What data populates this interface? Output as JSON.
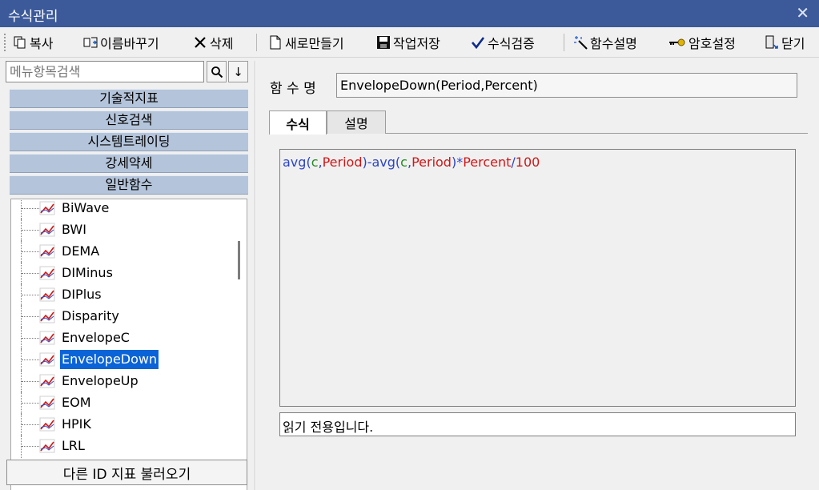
{
  "window": {
    "title": "수식관리"
  },
  "toolbar": {
    "copy": "복사",
    "rename": "이름바꾸기",
    "delete": "삭제",
    "new": "새로만들기",
    "save": "작업저장",
    "verify": "수식검증",
    "func_help": "함수설명",
    "password": "암호설정",
    "close": "닫기"
  },
  "search": {
    "placeholder": "메뉴항목검색"
  },
  "categories": [
    "기술적지표",
    "신호검색",
    "시스템트레이딩",
    "강세약세",
    "일반함수"
  ],
  "tree": {
    "items": [
      "BiWave",
      "BWI",
      "DEMA",
      "DIMinus",
      "DIPlus",
      "Disparity",
      "EnvelopeC",
      "EnvelopeDown",
      "EnvelopeUp",
      "EOM",
      "HPIK",
      "LRL"
    ],
    "selected": "EnvelopeDown"
  },
  "load_button": "다른 ID 지표 불러오기",
  "function": {
    "label": "함 수 명",
    "name": "EnvelopeDown(Period,Percent)"
  },
  "tabs": [
    "수식",
    "설명"
  ],
  "formula": {
    "tokens": [
      {
        "t": "avg",
        "c": "fn"
      },
      {
        "t": "(",
        "c": "fn"
      },
      {
        "t": "c",
        "c": "green"
      },
      {
        "t": ",",
        "c": "fn"
      },
      {
        "t": "Period",
        "c": "red"
      },
      {
        "t": ")-",
        "c": "fn"
      },
      {
        "t": "avg",
        "c": "fn"
      },
      {
        "t": "(",
        "c": "fn"
      },
      {
        "t": "c",
        "c": "green"
      },
      {
        "t": ",",
        "c": "fn"
      },
      {
        "t": "Period",
        "c": "red"
      },
      {
        "t": ")*",
        "c": "fn"
      },
      {
        "t": "Percent",
        "c": "red"
      },
      {
        "t": "/",
        "c": "fn"
      },
      {
        "t": "100",
        "c": "red"
      }
    ]
  },
  "status": "읽기 전용입니다.",
  "colors": {
    "titlebar": "#3c5a9a",
    "category": "#b4c4da",
    "selection": "#0a64d8",
    "keyword": "#2b45c8",
    "variable": "#d21515",
    "price": "#208a20"
  }
}
